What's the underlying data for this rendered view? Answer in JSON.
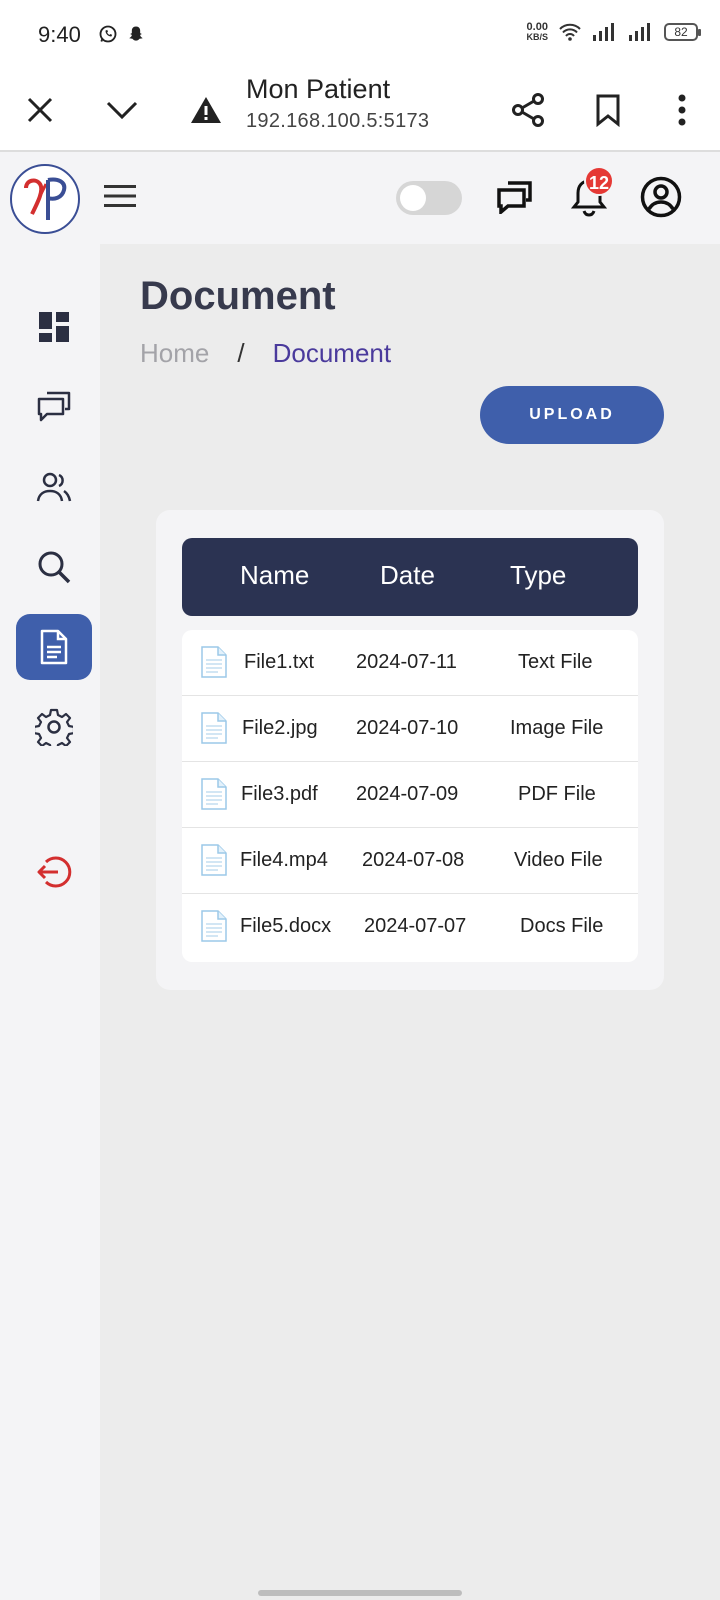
{
  "status": {
    "time": "9:40",
    "net_speed_value": "0.00",
    "net_speed_unit": "KB/S",
    "battery": "82"
  },
  "browser": {
    "title": "Mon Patient",
    "url": "192.168.100.5:5173"
  },
  "header": {
    "notification_count": "12"
  },
  "page": {
    "title": "Document",
    "breadcrumb": {
      "home": "Home",
      "separator": "/",
      "current": "Document"
    },
    "upload_label": "UPLOAD"
  },
  "table": {
    "headers": {
      "name": "Name",
      "date": "Date",
      "type": "Type"
    },
    "rows": [
      {
        "name": "File1.txt",
        "date": "2024-07-11",
        "type": "Text File"
      },
      {
        "name": "File2.jpg",
        "date": "2024-07-10",
        "type": "Image File"
      },
      {
        "name": "File3.pdf",
        "date": "2024-07-09",
        "type": "PDF File"
      },
      {
        "name": "File4.mp4",
        "date": "2024-07-08",
        "type": "Video File"
      },
      {
        "name": "File5.docx",
        "date": "2024-07-07",
        "type": "Docs File"
      }
    ]
  },
  "sidebar": {
    "items": [
      {
        "icon": "dashboard-icon",
        "active": false
      },
      {
        "icon": "chat-icon",
        "active": false
      },
      {
        "icon": "users-icon",
        "active": false
      },
      {
        "icon": "search-icon",
        "active": false
      },
      {
        "icon": "document-icon",
        "active": true
      },
      {
        "icon": "settings-icon",
        "active": false
      },
      {
        "icon": "logout-icon",
        "active": false
      }
    ]
  },
  "colors": {
    "accent": "#3f5fab",
    "table_header": "#2b3352",
    "breadcrumb_active": "#4a3a9c",
    "logout": "#d32f2f",
    "badge": "#e53935"
  }
}
